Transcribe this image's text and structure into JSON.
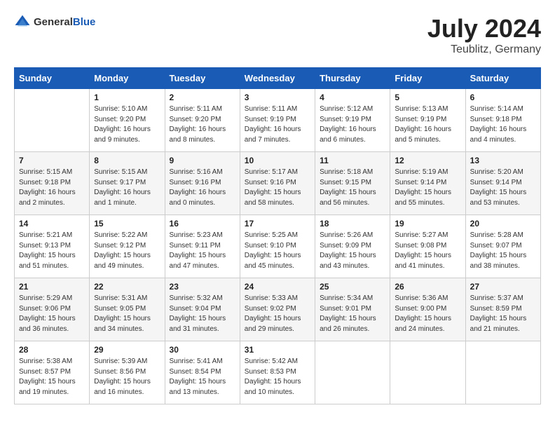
{
  "header": {
    "logo_general": "General",
    "logo_blue": "Blue",
    "month": "July 2024",
    "location": "Teublitz, Germany"
  },
  "days_of_week": [
    "Sunday",
    "Monday",
    "Tuesday",
    "Wednesday",
    "Thursday",
    "Friday",
    "Saturday"
  ],
  "weeks": [
    [
      {
        "num": "",
        "empty": true
      },
      {
        "num": "1",
        "sunrise": "Sunrise: 5:10 AM",
        "sunset": "Sunset: 9:20 PM",
        "daylight": "Daylight: 16 hours and 9 minutes."
      },
      {
        "num": "2",
        "sunrise": "Sunrise: 5:11 AM",
        "sunset": "Sunset: 9:20 PM",
        "daylight": "Daylight: 16 hours and 8 minutes."
      },
      {
        "num": "3",
        "sunrise": "Sunrise: 5:11 AM",
        "sunset": "Sunset: 9:19 PM",
        "daylight": "Daylight: 16 hours and 7 minutes."
      },
      {
        "num": "4",
        "sunrise": "Sunrise: 5:12 AM",
        "sunset": "Sunset: 9:19 PM",
        "daylight": "Daylight: 16 hours and 6 minutes."
      },
      {
        "num": "5",
        "sunrise": "Sunrise: 5:13 AM",
        "sunset": "Sunset: 9:19 PM",
        "daylight": "Daylight: 16 hours and 5 minutes."
      },
      {
        "num": "6",
        "sunrise": "Sunrise: 5:14 AM",
        "sunset": "Sunset: 9:18 PM",
        "daylight": "Daylight: 16 hours and 4 minutes."
      }
    ],
    [
      {
        "num": "7",
        "sunrise": "Sunrise: 5:15 AM",
        "sunset": "Sunset: 9:18 PM",
        "daylight": "Daylight: 16 hours and 2 minutes."
      },
      {
        "num": "8",
        "sunrise": "Sunrise: 5:15 AM",
        "sunset": "Sunset: 9:17 PM",
        "daylight": "Daylight: 16 hours and 1 minute."
      },
      {
        "num": "9",
        "sunrise": "Sunrise: 5:16 AM",
        "sunset": "Sunset: 9:16 PM",
        "daylight": "Daylight: 16 hours and 0 minutes."
      },
      {
        "num": "10",
        "sunrise": "Sunrise: 5:17 AM",
        "sunset": "Sunset: 9:16 PM",
        "daylight": "Daylight: 15 hours and 58 minutes."
      },
      {
        "num": "11",
        "sunrise": "Sunrise: 5:18 AM",
        "sunset": "Sunset: 9:15 PM",
        "daylight": "Daylight: 15 hours and 56 minutes."
      },
      {
        "num": "12",
        "sunrise": "Sunrise: 5:19 AM",
        "sunset": "Sunset: 9:14 PM",
        "daylight": "Daylight: 15 hours and 55 minutes."
      },
      {
        "num": "13",
        "sunrise": "Sunrise: 5:20 AM",
        "sunset": "Sunset: 9:14 PM",
        "daylight": "Daylight: 15 hours and 53 minutes."
      }
    ],
    [
      {
        "num": "14",
        "sunrise": "Sunrise: 5:21 AM",
        "sunset": "Sunset: 9:13 PM",
        "daylight": "Daylight: 15 hours and 51 minutes."
      },
      {
        "num": "15",
        "sunrise": "Sunrise: 5:22 AM",
        "sunset": "Sunset: 9:12 PM",
        "daylight": "Daylight: 15 hours and 49 minutes."
      },
      {
        "num": "16",
        "sunrise": "Sunrise: 5:23 AM",
        "sunset": "Sunset: 9:11 PM",
        "daylight": "Daylight: 15 hours and 47 minutes."
      },
      {
        "num": "17",
        "sunrise": "Sunrise: 5:25 AM",
        "sunset": "Sunset: 9:10 PM",
        "daylight": "Daylight: 15 hours and 45 minutes."
      },
      {
        "num": "18",
        "sunrise": "Sunrise: 5:26 AM",
        "sunset": "Sunset: 9:09 PM",
        "daylight": "Daylight: 15 hours and 43 minutes."
      },
      {
        "num": "19",
        "sunrise": "Sunrise: 5:27 AM",
        "sunset": "Sunset: 9:08 PM",
        "daylight": "Daylight: 15 hours and 41 minutes."
      },
      {
        "num": "20",
        "sunrise": "Sunrise: 5:28 AM",
        "sunset": "Sunset: 9:07 PM",
        "daylight": "Daylight: 15 hours and 38 minutes."
      }
    ],
    [
      {
        "num": "21",
        "sunrise": "Sunrise: 5:29 AM",
        "sunset": "Sunset: 9:06 PM",
        "daylight": "Daylight: 15 hours and 36 minutes."
      },
      {
        "num": "22",
        "sunrise": "Sunrise: 5:31 AM",
        "sunset": "Sunset: 9:05 PM",
        "daylight": "Daylight: 15 hours and 34 minutes."
      },
      {
        "num": "23",
        "sunrise": "Sunrise: 5:32 AM",
        "sunset": "Sunset: 9:04 PM",
        "daylight": "Daylight: 15 hours and 31 minutes."
      },
      {
        "num": "24",
        "sunrise": "Sunrise: 5:33 AM",
        "sunset": "Sunset: 9:02 PM",
        "daylight": "Daylight: 15 hours and 29 minutes."
      },
      {
        "num": "25",
        "sunrise": "Sunrise: 5:34 AM",
        "sunset": "Sunset: 9:01 PM",
        "daylight": "Daylight: 15 hours and 26 minutes."
      },
      {
        "num": "26",
        "sunrise": "Sunrise: 5:36 AM",
        "sunset": "Sunset: 9:00 PM",
        "daylight": "Daylight: 15 hours and 24 minutes."
      },
      {
        "num": "27",
        "sunrise": "Sunrise: 5:37 AM",
        "sunset": "Sunset: 8:59 PM",
        "daylight": "Daylight: 15 hours and 21 minutes."
      }
    ],
    [
      {
        "num": "28",
        "sunrise": "Sunrise: 5:38 AM",
        "sunset": "Sunset: 8:57 PM",
        "daylight": "Daylight: 15 hours and 19 minutes."
      },
      {
        "num": "29",
        "sunrise": "Sunrise: 5:39 AM",
        "sunset": "Sunset: 8:56 PM",
        "daylight": "Daylight: 15 hours and 16 minutes."
      },
      {
        "num": "30",
        "sunrise": "Sunrise: 5:41 AM",
        "sunset": "Sunset: 8:54 PM",
        "daylight": "Daylight: 15 hours and 13 minutes."
      },
      {
        "num": "31",
        "sunrise": "Sunrise: 5:42 AM",
        "sunset": "Sunset: 8:53 PM",
        "daylight": "Daylight: 15 hours and 10 minutes."
      },
      {
        "num": "",
        "empty": true
      },
      {
        "num": "",
        "empty": true
      },
      {
        "num": "",
        "empty": true
      }
    ]
  ]
}
